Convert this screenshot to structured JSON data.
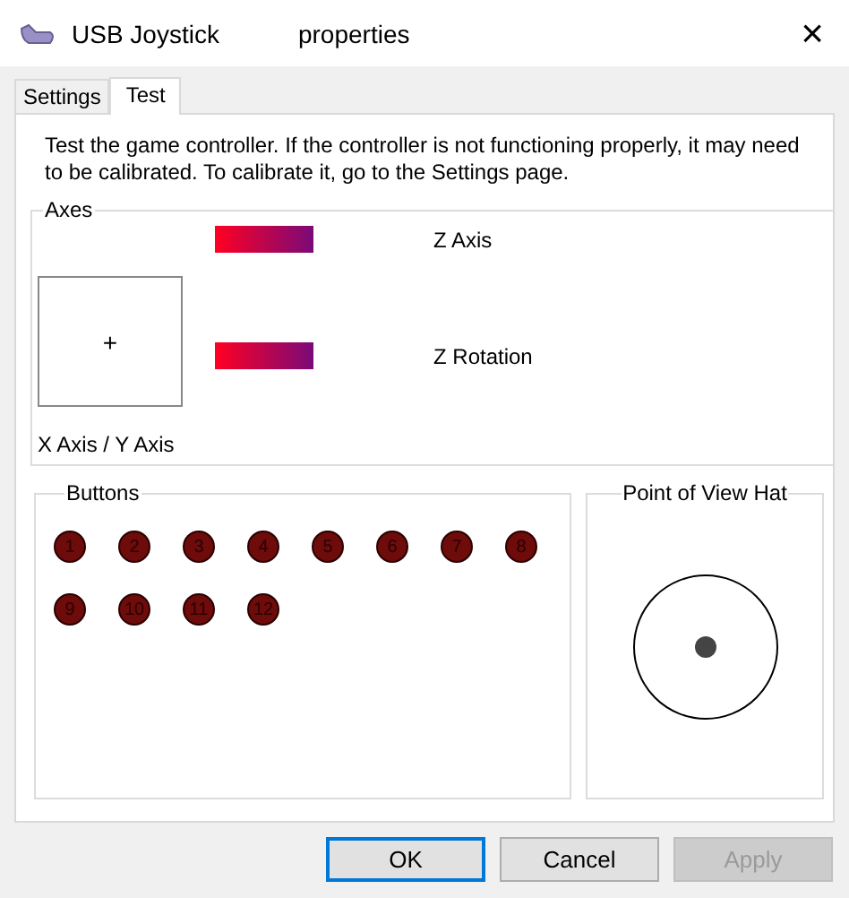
{
  "window": {
    "title": "USB Joystick",
    "title_suffix": "properties",
    "close": "×"
  },
  "tabs": [
    {
      "label": "Settings",
      "selected": false
    },
    {
      "label": "Test",
      "selected": true
    }
  ],
  "description": "Test the game controller.  If the controller is not functioning properly, it may need to be calibrated.  To calibrate it, go to the Settings page.",
  "axes": {
    "title": "Axes",
    "xy_label": "X Axis / Y Axis",
    "xy_marker": "+",
    "bars": [
      {
        "label": "Z Axis"
      },
      {
        "label": "Z Rotation"
      }
    ]
  },
  "buttons_group": {
    "title": "Buttons",
    "buttons": [
      {
        "label": "1",
        "pressed": false
      },
      {
        "label": "2",
        "pressed": false
      },
      {
        "label": "3",
        "pressed": false
      },
      {
        "label": "4",
        "pressed": false
      },
      {
        "label": "5",
        "pressed": false
      },
      {
        "label": "6",
        "pressed": false
      },
      {
        "label": "7",
        "pressed": false
      },
      {
        "label": "8",
        "pressed": false
      },
      {
        "label": "9",
        "pressed": false
      },
      {
        "label": "10",
        "pressed": false
      },
      {
        "label": "11",
        "pressed": false
      },
      {
        "label": "12",
        "pressed": false
      }
    ]
  },
  "pov_hat": {
    "title": "Point of View Hat"
  },
  "dialog_buttons": [
    {
      "label": "OK",
      "default": true,
      "disabled": false
    },
    {
      "label": "Cancel",
      "default": false,
      "disabled": false
    },
    {
      "label": "Apply",
      "default": false,
      "disabled": true
    }
  ]
}
